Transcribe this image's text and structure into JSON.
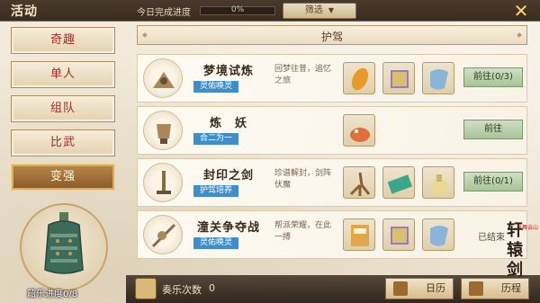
{
  "header": {
    "title": "活动",
    "progress_label": "今日完成进度",
    "progress_value": "0%",
    "progress_fraction": 0,
    "filter_label": "筛选",
    "close_icon": "close-icon"
  },
  "sidebar": {
    "items": [
      {
        "label": "奇趣",
        "active": false
      },
      {
        "label": "单人",
        "active": false
      },
      {
        "label": "组队",
        "active": false
      },
      {
        "label": "比武",
        "active": false
      },
      {
        "label": "变强",
        "active": true
      }
    ]
  },
  "bell": {
    "progress_label": "韶乐进度0/8"
  },
  "panel": {
    "title": "护驾",
    "rows": [
      {
        "name": "梦境试炼",
        "tag": "灵佑唤灵",
        "desc": "回梦往昔，追忆之旅",
        "action": "前往(0/3)",
        "rewards": [
          "amber-gem-icon",
          "tome-icon",
          "scroll-icon"
        ]
      },
      {
        "name": "炼　妖",
        "tag": "合二为一",
        "desc": "",
        "action": "前往",
        "rewards": [
          "fire-beast-icon"
        ]
      },
      {
        "name": "封印之剑",
        "tag": "护驾培养",
        "desc": "珍谱解封，剑阵伏魔",
        "action": "前往(0/1)",
        "rewards": [
          "root-item-icon",
          "green-book-icon",
          "jade-vase-icon"
        ]
      },
      {
        "name": "潼关争夺战",
        "tag": "灵佑唤灵",
        "desc": "帮派荣耀，在此一搏",
        "action": "已结束",
        "rewards": [
          "yellow-book-icon",
          "tome-icon",
          "scroll-icon"
        ]
      }
    ]
  },
  "footer": {
    "count_label": "奏乐次数",
    "count_value": "0",
    "calendar_label": "日历",
    "schedule_label": "历程"
  },
  "brand": {
    "text": "轩辕剑",
    "sub": "龙舞云山"
  }
}
